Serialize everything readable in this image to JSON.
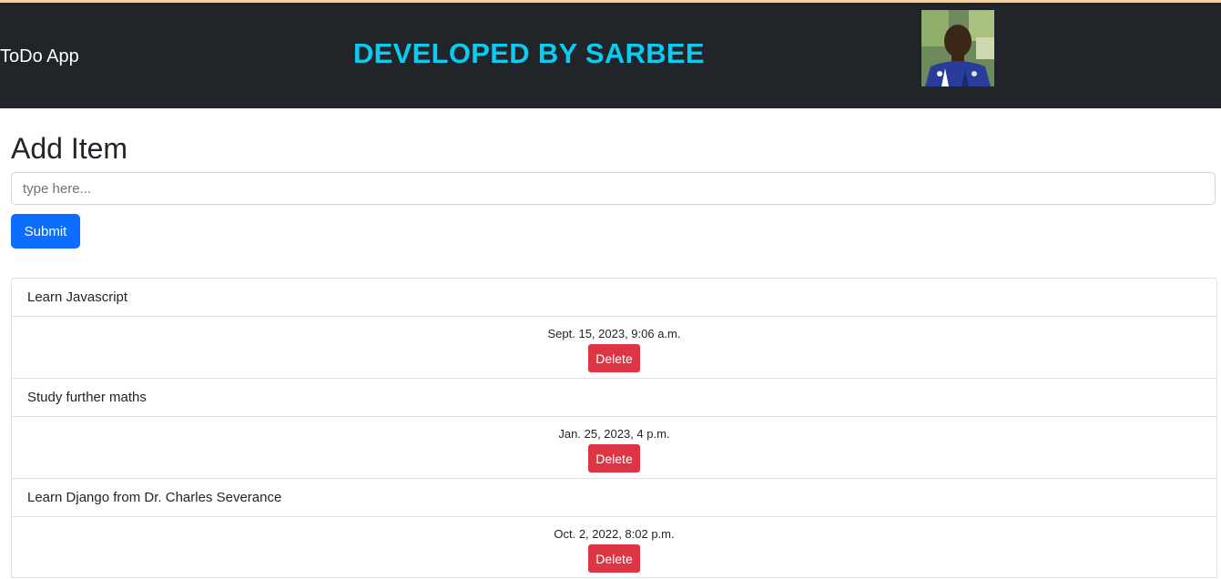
{
  "navbar": {
    "brand": "ToDo App",
    "developer_title": "DEVELOPED BY SARBEE",
    "accent_color": "#0dcaf0",
    "background_color": "#212529"
  },
  "form": {
    "heading": "Add Item",
    "input_placeholder": "type here...",
    "input_value": "",
    "submit_label": "Submit",
    "submit_color": "#0d6efd"
  },
  "items": [
    {
      "title": "Learn Javascript",
      "date": "Sept. 15, 2023, 9:06 a.m.",
      "delete_label": "Delete"
    },
    {
      "title": "Study further maths",
      "date": "Jan. 25, 2023, 4 p.m.",
      "delete_label": "Delete"
    },
    {
      "title": "Learn Django from Dr. Charles Severance",
      "date": "Oct. 2, 2022, 8:02 p.m.",
      "delete_label": "Delete"
    }
  ],
  "colors": {
    "delete": "#dc3545",
    "border": "#dee2e6"
  }
}
